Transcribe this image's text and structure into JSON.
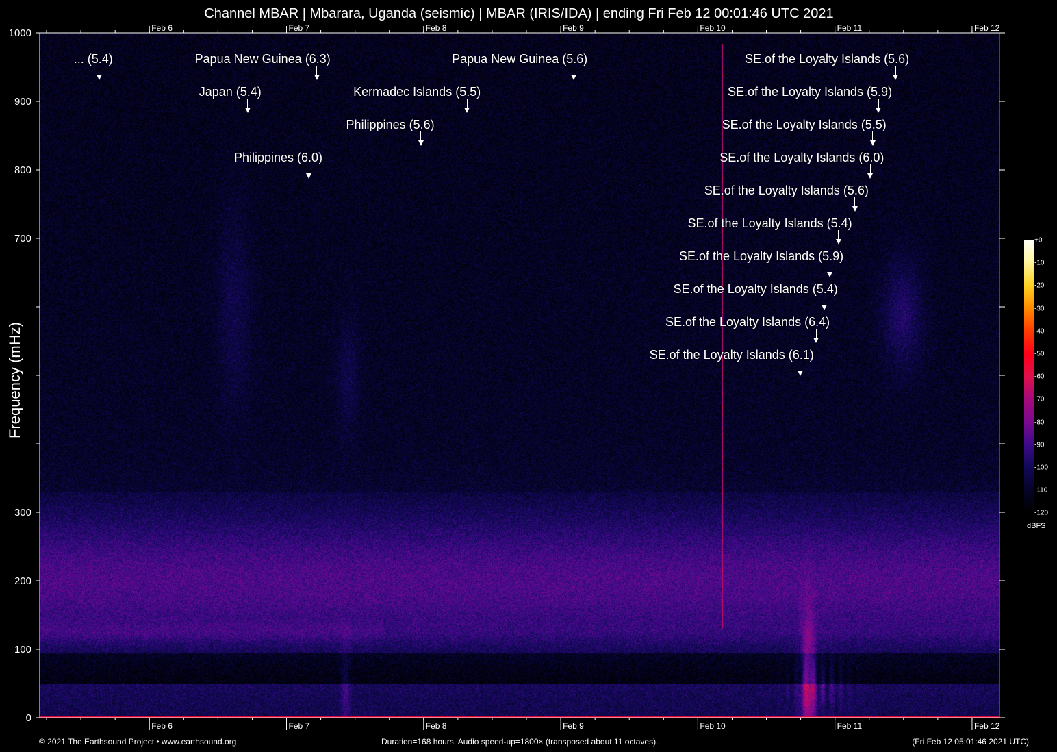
{
  "title": "Channel MBAR | Mbarara, Uganda (seismic) | MBAR (IRIS/IDA) | ending Fri Feb 12 00:01:46 UTC 2021",
  "footer": {
    "left": "© 2021 The Earthsound Project • www.earthsound.org",
    "center": "Duration=168 hours. Audio speed-up=1800× (transposed about 11 octaves).",
    "right": "(Fri Feb 12 05:01:46 2021 UTC)"
  },
  "chart_data": {
    "type": "heatmap",
    "title": "Channel MBAR | Mbarara, Uganda (seismic) | MBAR (IRIS/IDA) | ending Fri Feb 12 00:01:46 UTC 2021",
    "ylabel": "Frequency (mHz)",
    "ylim": [
      0,
      1000
    ],
    "xlim_hours": [
      0,
      168
    ],
    "y_ticks": [
      0,
      100,
      200,
      300,
      400,
      500,
      600,
      700,
      800,
      900,
      1000
    ],
    "y_tick_labels": [
      {
        "value": 1000,
        "label": "1000"
      },
      {
        "value": 900,
        "label": "900"
      },
      {
        "value": 800,
        "label": "800"
      },
      {
        "value": 700,
        "label": "700"
      },
      {
        "value": 300,
        "label": "300"
      },
      {
        "value": 200,
        "label": "200"
      },
      {
        "value": 100,
        "label": "100"
      },
      {
        "value": 0,
        "label": "0"
      }
    ],
    "x_ticks": [
      {
        "hour": 19.2,
        "label": "Feb 6"
      },
      {
        "hour": 43.2,
        "label": "Feb 7"
      },
      {
        "hour": 67.2,
        "label": "Feb 8"
      },
      {
        "hour": 91.2,
        "label": "Feb 9"
      },
      {
        "hour": 115.2,
        "label": "Feb 10"
      },
      {
        "hour": 139.2,
        "label": "Feb 11"
      },
      {
        "hour": 163.2,
        "label": "Feb 12"
      }
    ],
    "colorbar": {
      "unit": "dBFS",
      "range": [
        -120,
        0
      ],
      "labels": [
        "+0",
        "-10",
        "-20",
        "-30",
        "-40",
        "-50",
        "-60",
        "-70",
        "-80",
        "-90",
        "-100",
        "-110",
        "-120"
      ]
    },
    "events": [
      {
        "label": "... (5.4)",
        "hour": 10.4,
        "row": 0
      },
      {
        "label": "Papua New Guinea (6.3)",
        "hour": 48.5,
        "row": 0
      },
      {
        "label": "Japan (5.4)",
        "hour": 36.4,
        "row": 1
      },
      {
        "label": "Kermadec Islands (5.5)",
        "hour": 74.8,
        "row": 1
      },
      {
        "label": "Philippines (5.6)",
        "hour": 66.7,
        "row": 2
      },
      {
        "label": "Philippines (6.0)",
        "hour": 47.1,
        "row": 3
      },
      {
        "label": "Papua New Guinea (5.6)",
        "hour": 93.5,
        "row": 0
      },
      {
        "label": "SE.of the Loyalty Islands (5.6)",
        "hour": 149.8,
        "row": 0
      },
      {
        "label": "SE.of the Loyalty Islands (5.9)",
        "hour": 146.8,
        "row": 1
      },
      {
        "label": "SE.of the Loyalty Islands (5.5)",
        "hour": 145.8,
        "row": 2
      },
      {
        "label": "SE.of the Loyalty Islands (6.0)",
        "hour": 145.4,
        "row": 3
      },
      {
        "label": "SE.of the Loyalty Islands (5.6)",
        "hour": 142.7,
        "row": 4
      },
      {
        "label": "SE.of the Loyalty Islands (5.4)",
        "hour": 139.8,
        "row": 5
      },
      {
        "label": "SE.of the Loyalty Islands (5.9)",
        "hour": 138.3,
        "row": 6
      },
      {
        "label": "SE.of the Loyalty Islands (5.4)",
        "hour": 137.3,
        "row": 7
      },
      {
        "label": "SE.of the Loyalty Islands (6.4)",
        "hour": 135.9,
        "row": 8
      },
      {
        "label": "SE.of the Loyalty Islands (6.1)",
        "hour": 133.1,
        "row": 9
      }
    ]
  }
}
